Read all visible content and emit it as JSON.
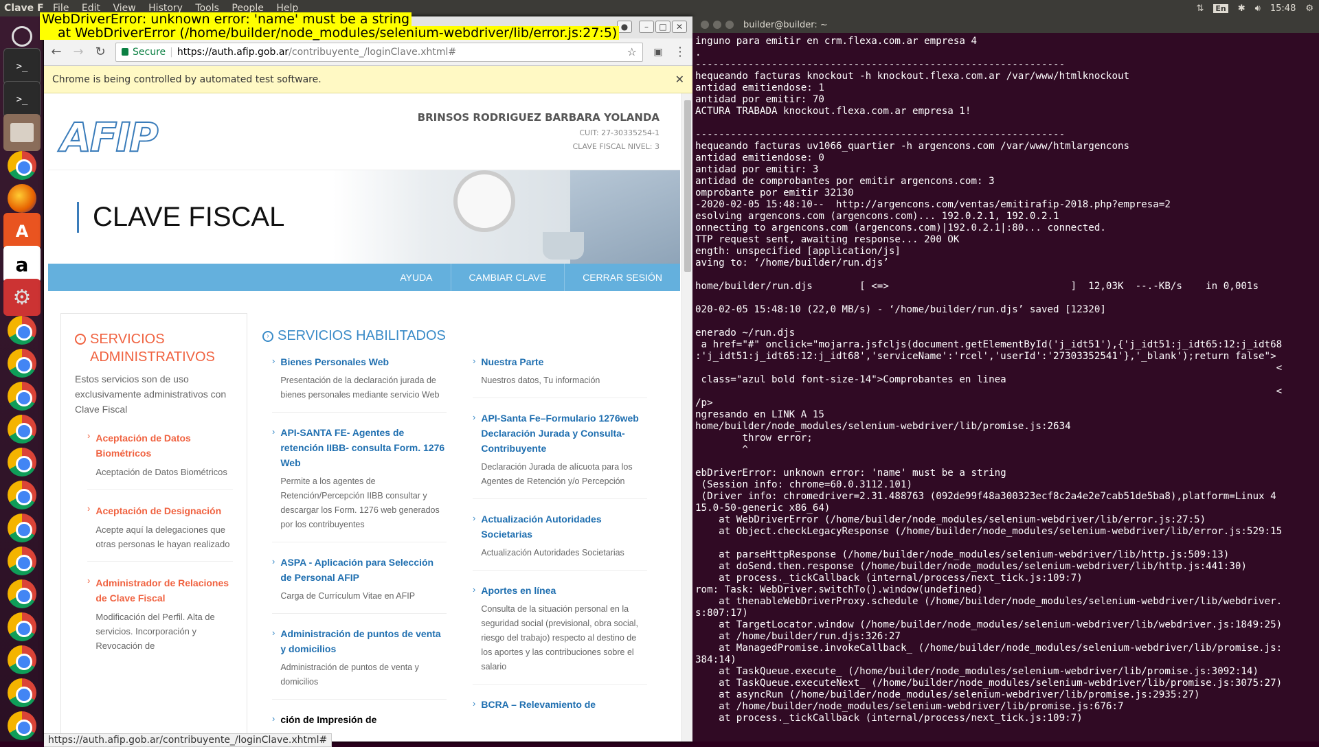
{
  "topbar": {
    "app_name": "Clave F",
    "menu": [
      "File",
      "Edit",
      "View",
      "History",
      "Tools",
      "People",
      "Help"
    ],
    "kb": "En",
    "time": "15:48"
  },
  "overlay": {
    "line1": "WebDriverError: unknown error: 'name' must be a string",
    "line2": "at WebDriverError (/home/builder/node_modules/selenium-webdriver/lib/error.js:27:5)"
  },
  "browser": {
    "secure_label": "Secure",
    "url_host": "https://auth.afip.gob.ar",
    "url_path": "/contribuyente_/loginClave.xhtml#",
    "infobar": "Chrome is being controlled by automated test software.",
    "status_url": "https://auth.afip.gob.ar/contribuyente_/loginClave.xhtml#"
  },
  "afip": {
    "logo": "AFIP",
    "user_name": "BRINSOS RODRIGUEZ BARBARA YOLANDA",
    "cuit": "CUIT: 27-30335254-1",
    "nivel": "CLAVE FISCAL NIVEL: 3",
    "hero_title": "CLAVE FISCAL",
    "nav": [
      "AYUDA",
      "CAMBIAR CLAVE",
      "CERRAR SESIÓN"
    ],
    "admin": {
      "title": "SERVICIOS ADMINISTRATIVOS",
      "desc": "Estos servicios son de uso exclusivamente administrativos con Clave Fiscal",
      "items": [
        {
          "title": "Aceptación de Datos Biométricos",
          "desc": "Aceptación de Datos Biométricos"
        },
        {
          "title": "Aceptación de Designación",
          "desc": "Acepte aquí la delegaciones que otras personas le hayan realizado"
        },
        {
          "title": "Administrador de Relaciones de Clave Fiscal",
          "desc": "Modificación del Perfil. Alta de servicios. Incorporación y Revocación de"
        }
      ]
    },
    "services": {
      "title": "SERVICIOS HABILITADOS",
      "left": [
        {
          "title": "Bienes Personales Web",
          "desc": "Presentación de la declaración jurada de bienes personales mediante servicio Web"
        },
        {
          "title": "API-SANTA FE- Agentes de retención IIBB- consulta Form. 1276 Web",
          "desc": "Permite a los agentes de Retención/Percepción IIBB consultar y descargar los Form. 1276 web generados por los contribuyentes"
        },
        {
          "title": "ASPA - Aplicación para Selección de Personal AFIP",
          "desc": "Carga de Currículum Vitae en AFIP"
        },
        {
          "title": "Administración de puntos de venta y domicilios",
          "desc": "Administración de puntos de venta y domicilios"
        },
        {
          "title": "ción de Impresión de",
          "desc": ""
        }
      ],
      "right": [
        {
          "title": "Nuestra Parte",
          "desc": "Nuestros datos, Tu información"
        },
        {
          "title": "API-Santa Fe–Formulario 1276web Declaración Jurada y Consulta-Contribuyente",
          "desc": "Declaración Jurada de alícuota para los Agentes de Retención y/o Percepción"
        },
        {
          "title": "Actualización Autoridades Societarias",
          "desc": "Actualización Autoridades Societarias"
        },
        {
          "title": "Aportes en línea",
          "desc": "Consulta de la situación personal en la seguridad social (previsional, obra social, riesgo del trabajo) respecto al destino de los aportes y las contribuciones sobre el salario"
        },
        {
          "title": "BCRA – Relevamiento de",
          "desc": ""
        }
      ]
    }
  },
  "terminal": {
    "title": "builder@builder: ~",
    "text": "inguno para emitir en crm.flexa.com.ar empresa 4\n.\n---------------------------------------------------------------\nhequeando facturas knockout -h knockout.flexa.com.ar /var/www/htmlknockout\nantidad emitiendose: 1\nantidad por emitir: 70\nACTURA TRABADA knockout.flexa.com.ar empresa 1!\n\n---------------------------------------------------------------\nhequeando facturas uv1066_quartier -h argencons.com /var/www/htmlargencons\nantidad emitiendose: 0\nantidad por emitir: 3\nantidad de comprobantes por emitir argencons.com: 3\nomprobante por emitir 32130\n-2020-02-05 15:48:10--  http://argencons.com/ventas/emitirafip-2018.php?empresa=2\nesolving argencons.com (argencons.com)... 192.0.2.1, 192.0.2.1\nonnecting to argencons.com (argencons.com)|192.0.2.1|:80... connected.\nTTP request sent, awaiting response... 200 OK\nength: unspecified [application/js]\naving to: ‘/home/builder/run.djs’\n\nhome/builder/run.djs        [ <=>                               ]  12,03K  --.-KB/s    in 0,001s\n\n020-02-05 15:48:10 (22,0 MB/s) - ‘/home/builder/run.djs’ saved [12320]\n\nenerado ~/run.djs\n a href=\"#\" onclick=\"mojarra.jsfcljs(document.getElementById('j_idt51'),{'j_idt51:j_idt65:12:j_idt68\n:'j_idt51:j_idt65:12:j_idt68','serviceName':'rcel','userId':'27303352541'},'_blank');return false\">\n                                                                                                   <\n class=\"azul bold font-size-14\">Comprobantes en linea\n                                                                                                   <\n/p>\nngresando en LINK A 15\nhome/builder/node_modules/selenium-webdriver/lib/promise.js:2634\n        throw error;\n        ^\n\nebDriverError: unknown error: 'name' must be a string\n (Session info: chrome=60.0.3112.101)\n (Driver info: chromedriver=2.31.488763 (092de99f48a300323ecf8c2a4e2e7cab51de5ba8),platform=Linux 4\n15.0-50-generic x86_64)\n    at WebDriverError (/home/builder/node_modules/selenium-webdriver/lib/error.js:27:5)\n    at Object.checkLegacyResponse (/home/builder/node_modules/selenium-webdriver/lib/error.js:529:15\n\n    at parseHttpResponse (/home/builder/node_modules/selenium-webdriver/lib/http.js:509:13)\n    at doSend.then.response (/home/builder/node_modules/selenium-webdriver/lib/http.js:441:30)\n    at process._tickCallback (internal/process/next_tick.js:109:7)\nrom: Task: WebDriver.switchTo().window(undefined)\n    at thenableWebDriverProxy.schedule (/home/builder/node_modules/selenium-webdriver/lib/webdriver.\ns:807:17)\n    at TargetLocator.window (/home/builder/node_modules/selenium-webdriver/lib/webdriver.js:1849:25)\n    at /home/builder/run.djs:326:27\n    at ManagedPromise.invokeCallback_ (/home/builder/node_modules/selenium-webdriver/lib/promise.js:\n384:14)\n    at TaskQueue.execute_ (/home/builder/node_modules/selenium-webdriver/lib/promise.js:3092:14)\n    at TaskQueue.executeNext_ (/home/builder/node_modules/selenium-webdriver/lib/promise.js:3075:27)\n    at asyncRun (/home/builder/node_modules/selenium-webdriver/lib/promise.js:2935:27)\n    at /home/builder/node_modules/selenium-webdriver/lib/promise.js:676:7\n    at process._tickCallback (internal/process/next_tick.js:109:7)"
  }
}
